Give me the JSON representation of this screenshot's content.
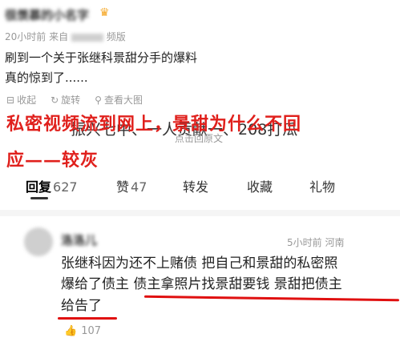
{
  "post": {
    "author_name": "很羡慕的小名字",
    "meta_time": "20小时前",
    "meta_source_prefix": "来自",
    "meta_source_suffix": "频版",
    "text_line1": "刷到一个关于张继科景甜分手的爆料",
    "text_line2": "真的惊到了......",
    "action_collapse": "收起",
    "action_rotate": "旋转",
    "action_zoom": "查看大图"
  },
  "quote": {
    "text": "振兴七中、一人贡献一、208打瓜",
    "hint": "点击回原文"
  },
  "annotation": {
    "line1": "私密视频流到网上，景甜为什么不回",
    "line2": "应——较灰"
  },
  "tabs": [
    {
      "label": "回复",
      "count": "627",
      "active": true
    },
    {
      "label": "赞",
      "count": "47",
      "active": false
    },
    {
      "label": "转发",
      "count": "",
      "active": false
    },
    {
      "label": "收藏",
      "count": "",
      "active": false
    },
    {
      "label": "礼物",
      "count": "",
      "active": false
    }
  ],
  "comment": {
    "user_name": "洛洛儿",
    "time": "5小时前",
    "location": "河南",
    "line1": "张继科因为还不上赌债 把自己和景甜的私密照",
    "line2a": "爆给了债主",
    "line2b": "债主拿照片找景甜要钱 景甜把债主",
    "line3": "给告了",
    "like_count": "107"
  },
  "colors": {
    "annotation_red": "#e0201c",
    "muted_text": "#999999",
    "divider": "#eeeeee"
  }
}
